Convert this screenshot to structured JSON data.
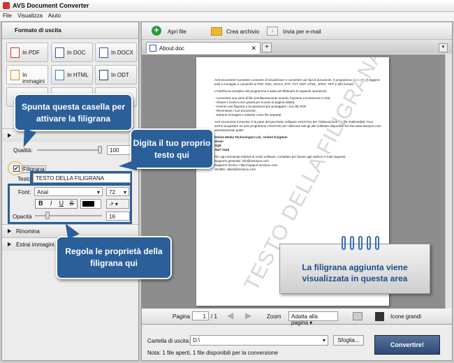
{
  "app": {
    "title": "AVS Document Converter"
  },
  "menu": [
    "File",
    "Visualizza",
    "Aiuto"
  ],
  "left": {
    "header": "Formato di uscita",
    "formats": [
      "In PDF",
      "In DOC",
      "In DOCX",
      "In immagini",
      "In HTML",
      "In ODT"
    ],
    "quality_label": "Qualità:",
    "quality_value": "100",
    "quality_fraction": 1.0,
    "watermark_label": "Filigrana",
    "watermark_checked": true,
    "text_label": "Testo",
    "text_value": "TESTO DELLA FILIGRANA",
    "font_label": "Font:",
    "font_value": "Arial",
    "size_value": "72",
    "style_buttons": [
      "B",
      "I",
      "U",
      "S"
    ],
    "opacity_label": "Opacità",
    "opacity_value": "16",
    "opacity_fraction": 0.16,
    "sections": [
      "Rinomina",
      "Estrai immagini"
    ]
  },
  "callouts": {
    "checkbox": "Spunta questa casella per attivare la filigrana",
    "text": "Digita il tuo proprio testo qui",
    "props": "Regola le proprietà della filigrana qui",
    "area": "La filigrana aggiunta viene visualizzata in questa area"
  },
  "toolbar": {
    "open": "Apri file",
    "archive": "Crea archivio",
    "email": "Invia per e-mail"
  },
  "tab": {
    "name": "About.doc",
    "add": "+"
  },
  "document": {
    "paragraphs": [
      "AVS Document Converter consente di visualizzare e convertire vari tipi di documenti. Il programma permette di leggere testi e immagini e convertirli in PDF, DOC, DOCX, RTF, TXT, ODT, HTML, JPEG, TIFF e altri formati.",
      "L'interfaccia semplice del programma ti aiuta ad effettuare le seguenti operazioni:",
      "- Convertire una serie di file simultaneamente usando l'opzione Conversione in lotti;\n- Allvare il modo icone grandi per trovare la pagina adatta;\n- Inserire una filigrana e la password per proteggere i tuoi file PDF;\n- Rinominare i tuoi documenti;\n- Estrarre immagini e salvarle come file separati.",
      "AVS Document Converter è la parte del pacchetto software AVS4YOU per l'elaborazione dei file multimediali. Puoi anche acquistare un solo programma AVS4YOU per utilizzare tutti gli altri software disponibili sul sito www.avs4you.com assolutamente gratis.",
      "Online Media Technologies Ltd., United Kingdom\nStreet\nSQR\n7637 0419",
      "Per ogni domanda relativa ai nostri software, contattaci per favore agli indirizzi e-mail seguenti:\nSupporto generale: info@avs4you.com\nSupporto tecnico: http://support.avs4you.com\nVendite: sales@avs4you.com"
    ],
    "watermark": "TESTO DELLA FILIGRANA"
  },
  "nav": {
    "page_label": "Pagina",
    "page_value": "1",
    "page_total": "/ 1",
    "zoom_label": "Zoom",
    "zoom_value": "Adatta alla pagina",
    "large_icons": "Icone grandi"
  },
  "bottom": {
    "folder_label": "Cartella di uscita:",
    "folder_value": "D:\\",
    "browse": "Sfoglia...",
    "convert": "Convertire!",
    "note": "Nota: 1 file aperti, 1 file disponibili per la conversione"
  }
}
